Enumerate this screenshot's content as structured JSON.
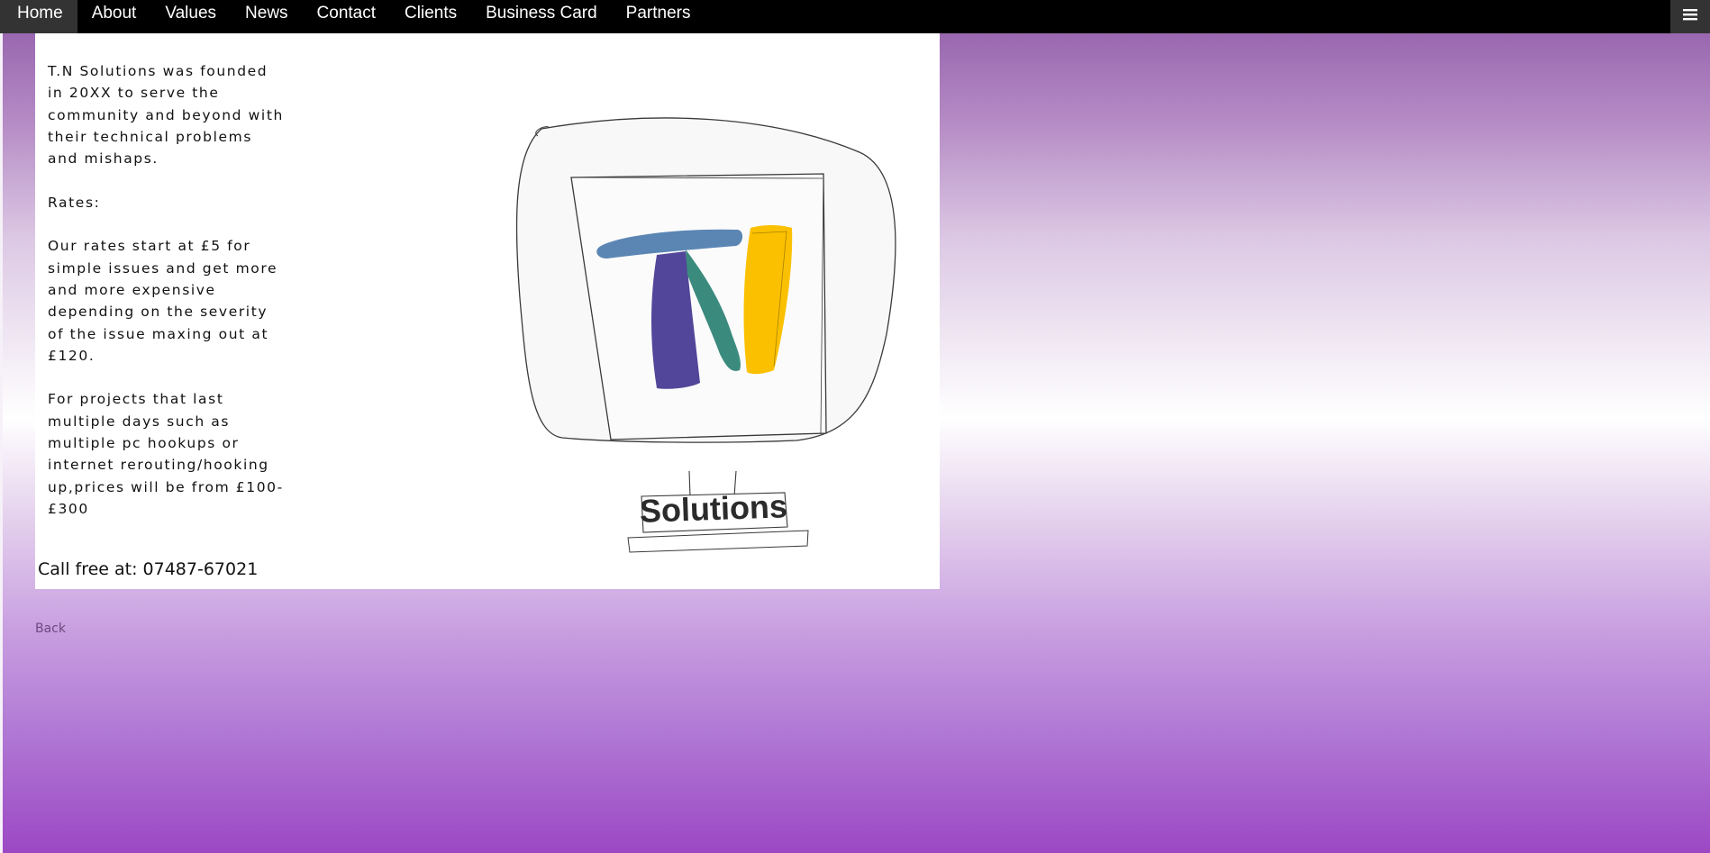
{
  "nav": {
    "items": [
      {
        "label": "Home",
        "active": true
      },
      {
        "label": "About",
        "active": false
      },
      {
        "label": "Values",
        "active": false
      },
      {
        "label": "News",
        "active": false
      },
      {
        "label": "Contact",
        "active": false
      },
      {
        "label": "Clients",
        "active": false
      },
      {
        "label": "Business Card",
        "active": false
      },
      {
        "label": "Partners",
        "active": false
      }
    ],
    "menu_icon": "hamburger-icon"
  },
  "content": {
    "intro": "T.N Solutions was founded in 20XX to serve the community and beyond with their technical problems and mishaps.",
    "rates_heading": "Rates:",
    "rates_text": "Our rates start at £5 for simple issues and get more and more expensive depending on the severity of the issue maxing out at £120.",
    "projects_text": "For projects that last multiple days such as multiple pc hookups or internet rerouting/hooking up,prices will be from £100-£300",
    "logo_word": "Solutions",
    "call_text": "Call free at: 07487-67021"
  },
  "footer": {
    "back_label": "Back"
  },
  "colors": {
    "nav_bg": "#000000",
    "nav_active_bg": "#333333",
    "logo_blue": "#5b86b4",
    "logo_purple": "#514699",
    "logo_teal": "#3b8a7e",
    "logo_yellow": "#fbc101"
  }
}
